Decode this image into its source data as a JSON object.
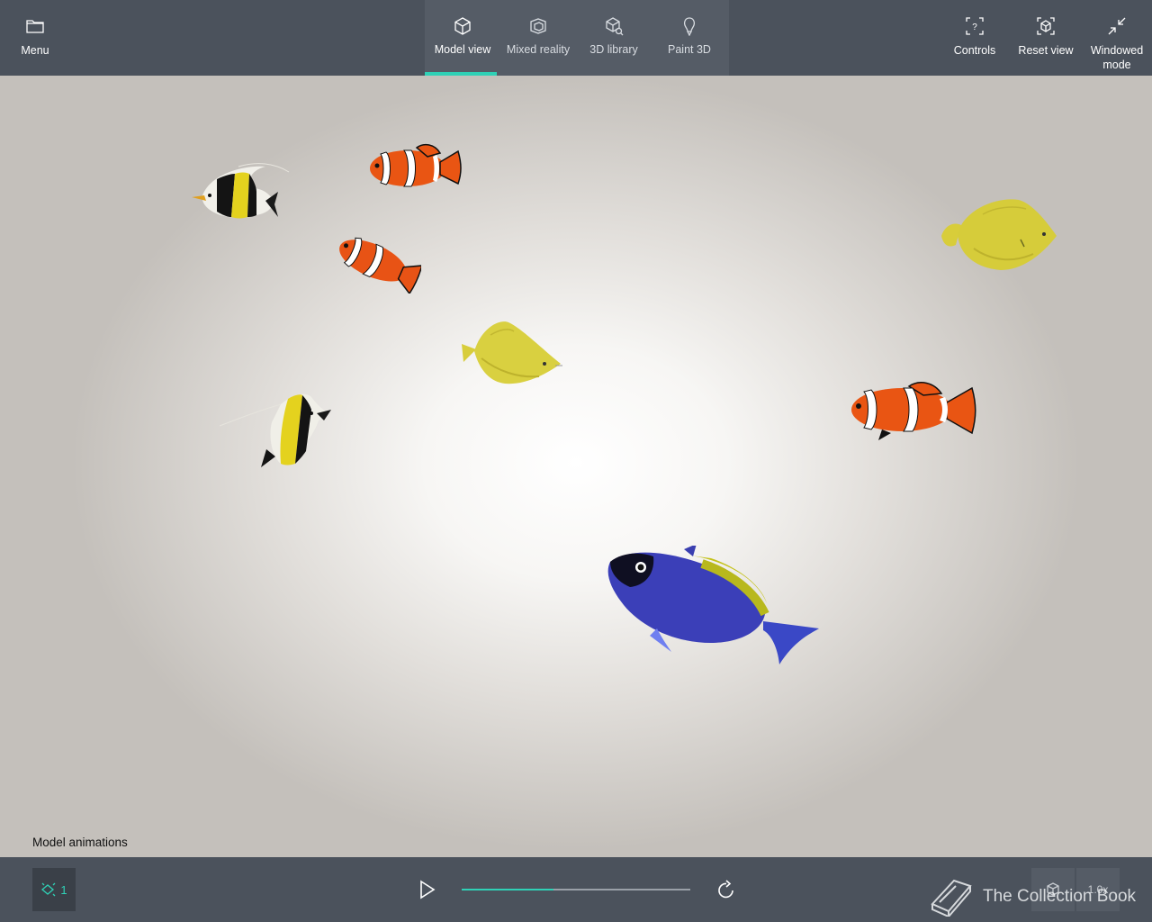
{
  "toolbar": {
    "menu": {
      "label": "Menu",
      "icon": "folder-icon"
    },
    "tabs": [
      {
        "label": "Model view",
        "icon": "cube-icon",
        "active": true
      },
      {
        "label": "Mixed reality",
        "icon": "mixed-reality-icon",
        "active": false
      },
      {
        "label": "3D library",
        "icon": "library-icon",
        "active": false
      },
      {
        "label": "Paint 3D",
        "icon": "paint-icon",
        "active": false
      }
    ],
    "controls": {
      "label": "Controls",
      "icon": "controls-icon"
    },
    "reset_view": {
      "label": "Reset view",
      "icon": "reset-view-icon"
    },
    "windowed_mode": {
      "label_line1": "Windowed",
      "label_line2": "mode",
      "icon": "windowed-mode-icon"
    }
  },
  "scene": {
    "fish": [
      {
        "kind": "moorish-idol"
      },
      {
        "kind": "clownfish"
      },
      {
        "kind": "clownfish"
      },
      {
        "kind": "yellow-tang"
      },
      {
        "kind": "yellow-tang"
      },
      {
        "kind": "moorish-idol"
      },
      {
        "kind": "clownfish"
      },
      {
        "kind": "powder-blue-tang"
      }
    ]
  },
  "animations": {
    "label": "Model animations",
    "count": "1",
    "progress": 0.4,
    "speed": "1.0x"
  },
  "watermark": {
    "text": "The Collection Book",
    "icon": "book-icon"
  },
  "colors": {
    "accent": "#2fd1b6",
    "toolbar_bg": "#4b525c",
    "tabgroup_bg": "#555c66"
  }
}
